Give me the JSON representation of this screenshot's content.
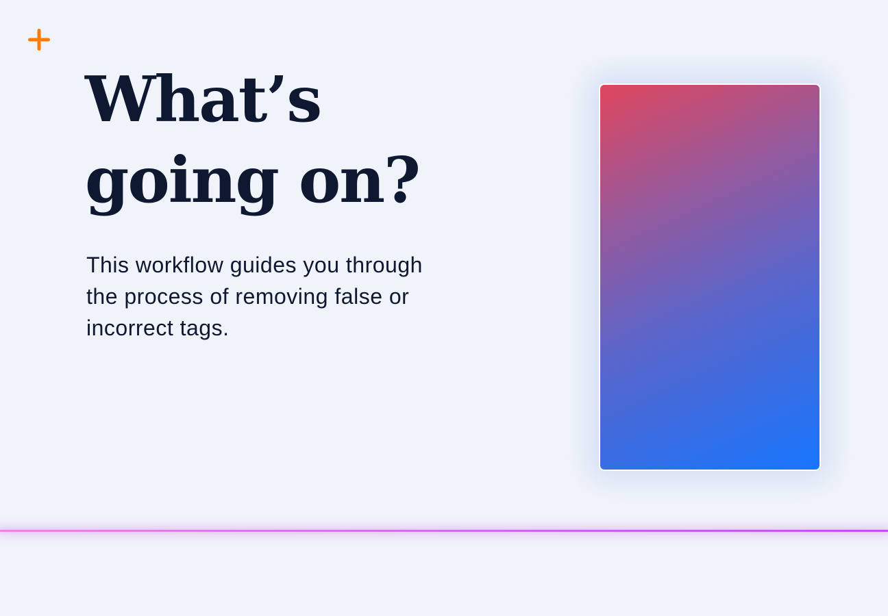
{
  "brand": {
    "icon": "plus-icon",
    "accent_color": "#ff7a00"
  },
  "intro": {
    "headline_lines": [
      "What’s",
      "going on?"
    ],
    "description_lines": [
      "This workflow guides you through",
      "the process of removing false or",
      "incorrect tags."
    ]
  },
  "illustration": {
    "gradient_colors": [
      "#e0475e",
      "#9a5898",
      "#5966cc",
      "#1775fd"
    ]
  },
  "divider": {
    "colors": [
      "#ee82ee",
      "#c34ef1"
    ]
  }
}
